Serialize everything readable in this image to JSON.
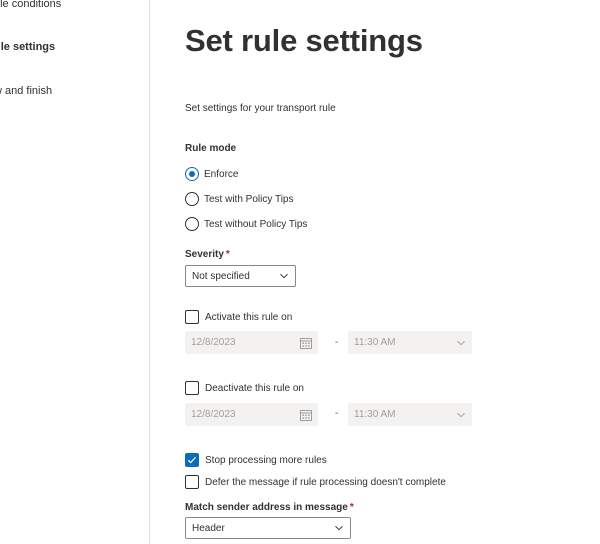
{
  "steps": [
    {
      "label": "ule conditions"
    },
    {
      "label": "ule settings"
    },
    {
      "label": "w and finish"
    }
  ],
  "page": {
    "title": "Set rule settings",
    "subtitle": "Set settings for your transport rule"
  },
  "rule_mode": {
    "label": "Rule mode",
    "options": [
      {
        "label": "Enforce",
        "checked": true
      },
      {
        "label": "Test with Policy Tips",
        "checked": false
      },
      {
        "label": "Test without Policy Tips",
        "checked": false
      }
    ]
  },
  "severity": {
    "label": "Severity",
    "required_mark": "*",
    "value": "Not specified"
  },
  "activate": {
    "label": "Activate this rule on",
    "checked": false,
    "date": "12/8/2023",
    "separator": "-",
    "time": "11:30 AM"
  },
  "deactivate": {
    "label": "Deactivate this rule on",
    "checked": false,
    "date": "12/8/2023",
    "separator": "-",
    "time": "11:30 AM"
  },
  "stop_processing": {
    "label": "Stop processing more rules",
    "checked": true
  },
  "defer_message": {
    "label": "Defer the message if rule processing doesn't complete",
    "checked": false
  },
  "match_sender": {
    "label": "Match sender address in message",
    "required_mark": "*",
    "value": "Header"
  },
  "colors": {
    "accent": "#0f6cbd",
    "required": "#a4262c",
    "disabled_bg": "#f3f2f1"
  }
}
